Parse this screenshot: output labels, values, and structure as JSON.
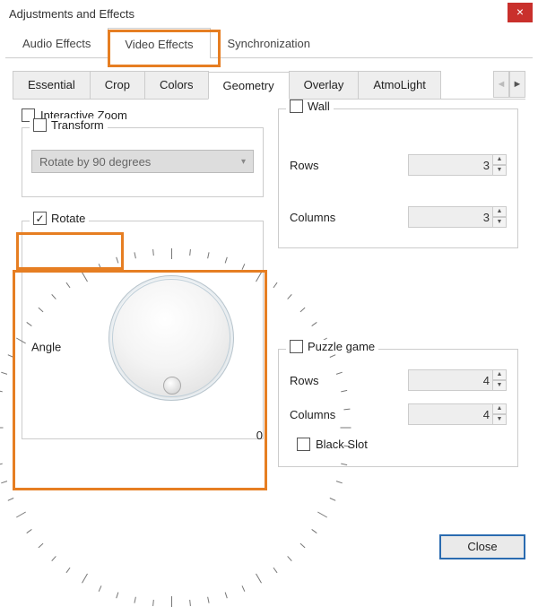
{
  "window": {
    "title": "Adjustments and Effects"
  },
  "primary_tabs": {
    "audio": "Audio Effects",
    "video": "Video Effects",
    "sync": "Synchronization"
  },
  "secondary_tabs": {
    "essential": "Essential",
    "crop": "Crop",
    "colors": "Colors",
    "geometry": "Geometry",
    "overlay": "Overlay",
    "atmolight": "AtmoLight"
  },
  "left": {
    "interactive_zoom": "Interactive Zoom",
    "transform": "Transform",
    "transform_option": "Rotate by 90 degrees",
    "rotate": "Rotate",
    "angle": "Angle",
    "angle_zero": "0"
  },
  "right": {
    "wall": {
      "title": "Wall",
      "rows_label": "Rows",
      "rows_value": "3",
      "cols_label": "Columns",
      "cols_value": "3"
    },
    "puzzle": {
      "title": "Puzzle game",
      "rows_label": "Rows",
      "rows_value": "4",
      "cols_label": "Columns",
      "cols_value": "4",
      "black_slot": "Black Slot"
    }
  },
  "buttons": {
    "close": "Close"
  },
  "highlight_color": "#e67e22"
}
